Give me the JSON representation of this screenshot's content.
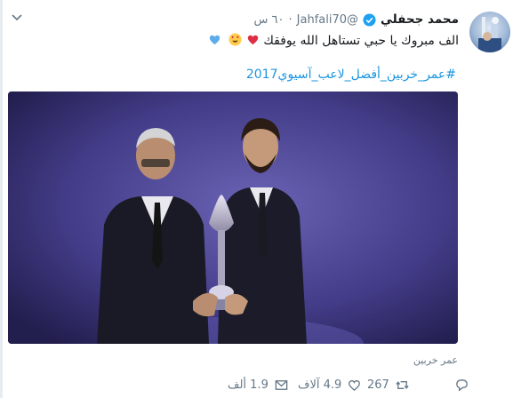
{
  "user": {
    "name": "محمد جحفلي",
    "handle": "@Jahfali70",
    "time": "٦٠ س"
  },
  "tweet": {
    "text": "الف مبروك يا حبي تستاهل الله يوفقك",
    "hashtag": "#عمر_خربين_أفضل_لاعب_آسيوي2017"
  },
  "media": {
    "caption": "عمر خربين"
  },
  "actions": {
    "reply_count": "",
    "retweet_count": "267",
    "like_count": "4.9 آلاف",
    "dm_count": "1.9 ألف"
  },
  "colors": {
    "link": "#1b95e0",
    "secondary_text": "#657786",
    "verified": "#1da1f2",
    "heart": "#e0245e"
  }
}
